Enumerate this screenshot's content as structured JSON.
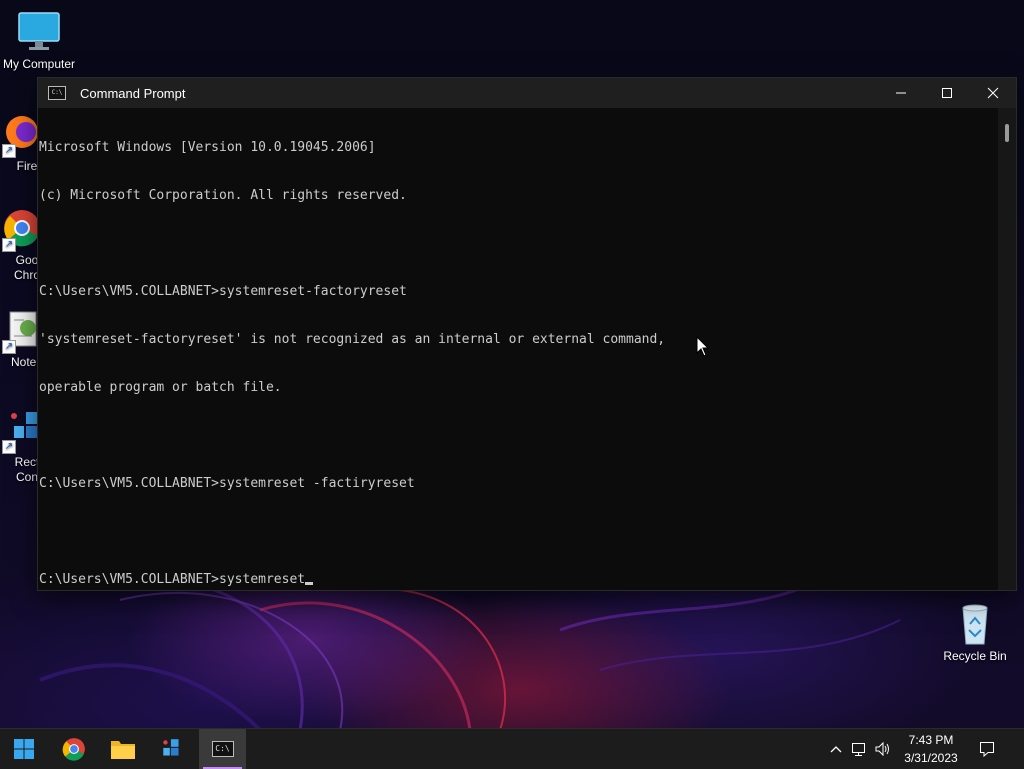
{
  "desktop": {
    "icons": [
      {
        "label": "My Computer",
        "icon": "monitor-icon"
      },
      {
        "label": "Fire",
        "icon": "firefox-icon"
      },
      {
        "label": "Goo\nChro",
        "icon": "chrome-icon"
      },
      {
        "label": "Notep",
        "icon": "notepad-icon"
      },
      {
        "label": "Rect\nCon",
        "icon": "remote-connection-icon"
      },
      {
        "label": "Recycle Bin",
        "icon": "recycle-bin-icon"
      }
    ]
  },
  "window": {
    "title": "Command Prompt",
    "icon_text": "C:\\",
    "console_lines": [
      "Microsoft Windows [Version 10.0.19045.2006]",
      "(c) Microsoft Corporation. All rights reserved.",
      "",
      "C:\\Users\\VM5.COLLABNET>systemreset-factoryreset",
      "'systemreset-factoryreset' is not recognized as an internal or external command,",
      "operable program or batch file.",
      "",
      "C:\\Users\\VM5.COLLABNET>systemreset -factiryreset",
      "",
      "C:\\Users\\VM5.COLLABNET>systemreset"
    ]
  },
  "taskbar": {
    "apps": [
      {
        "name": "start",
        "icon": "windows-start-icon"
      },
      {
        "name": "chrome",
        "icon": "chrome-icon"
      },
      {
        "name": "file-explorer",
        "icon": "folder-icon"
      },
      {
        "name": "remote-connection",
        "icon": "remote-connection-icon"
      },
      {
        "name": "command-prompt",
        "icon": "cmd-icon",
        "label": "C:\\"
      }
    ],
    "clock": {
      "time": "7:43 PM",
      "date": "3/31/2023"
    }
  },
  "colors": {
    "console_bg": "#0c0c0c",
    "console_fg": "#cccccc",
    "titlebar": "#1f1f1f",
    "taskbar": "#1c1c1c",
    "active_indicator": "#c58af9"
  }
}
